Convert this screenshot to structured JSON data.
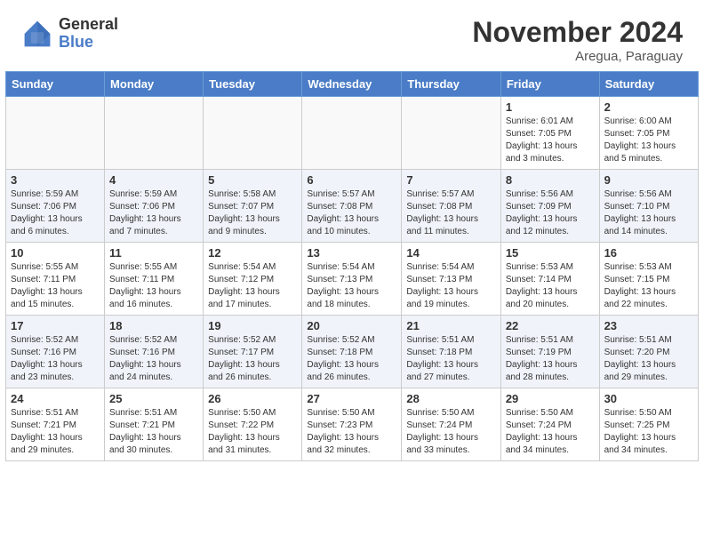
{
  "header": {
    "logo_general": "General",
    "logo_blue": "Blue",
    "month_title": "November 2024",
    "location": "Aregua, Paraguay"
  },
  "weekdays": [
    "Sunday",
    "Monday",
    "Tuesday",
    "Wednesday",
    "Thursday",
    "Friday",
    "Saturday"
  ],
  "weeks": [
    [
      {
        "day": "",
        "info": ""
      },
      {
        "day": "",
        "info": ""
      },
      {
        "day": "",
        "info": ""
      },
      {
        "day": "",
        "info": ""
      },
      {
        "day": "",
        "info": ""
      },
      {
        "day": "1",
        "info": "Sunrise: 6:01 AM\nSunset: 7:05 PM\nDaylight: 13 hours\nand 3 minutes."
      },
      {
        "day": "2",
        "info": "Sunrise: 6:00 AM\nSunset: 7:05 PM\nDaylight: 13 hours\nand 5 minutes."
      }
    ],
    [
      {
        "day": "3",
        "info": "Sunrise: 5:59 AM\nSunset: 7:06 PM\nDaylight: 13 hours\nand 6 minutes."
      },
      {
        "day": "4",
        "info": "Sunrise: 5:59 AM\nSunset: 7:06 PM\nDaylight: 13 hours\nand 7 minutes."
      },
      {
        "day": "5",
        "info": "Sunrise: 5:58 AM\nSunset: 7:07 PM\nDaylight: 13 hours\nand 9 minutes."
      },
      {
        "day": "6",
        "info": "Sunrise: 5:57 AM\nSunset: 7:08 PM\nDaylight: 13 hours\nand 10 minutes."
      },
      {
        "day": "7",
        "info": "Sunrise: 5:57 AM\nSunset: 7:08 PM\nDaylight: 13 hours\nand 11 minutes."
      },
      {
        "day": "8",
        "info": "Sunrise: 5:56 AM\nSunset: 7:09 PM\nDaylight: 13 hours\nand 12 minutes."
      },
      {
        "day": "9",
        "info": "Sunrise: 5:56 AM\nSunset: 7:10 PM\nDaylight: 13 hours\nand 14 minutes."
      }
    ],
    [
      {
        "day": "10",
        "info": "Sunrise: 5:55 AM\nSunset: 7:11 PM\nDaylight: 13 hours\nand 15 minutes."
      },
      {
        "day": "11",
        "info": "Sunrise: 5:55 AM\nSunset: 7:11 PM\nDaylight: 13 hours\nand 16 minutes."
      },
      {
        "day": "12",
        "info": "Sunrise: 5:54 AM\nSunset: 7:12 PM\nDaylight: 13 hours\nand 17 minutes."
      },
      {
        "day": "13",
        "info": "Sunrise: 5:54 AM\nSunset: 7:13 PM\nDaylight: 13 hours\nand 18 minutes."
      },
      {
        "day": "14",
        "info": "Sunrise: 5:54 AM\nSunset: 7:13 PM\nDaylight: 13 hours\nand 19 minutes."
      },
      {
        "day": "15",
        "info": "Sunrise: 5:53 AM\nSunset: 7:14 PM\nDaylight: 13 hours\nand 20 minutes."
      },
      {
        "day": "16",
        "info": "Sunrise: 5:53 AM\nSunset: 7:15 PM\nDaylight: 13 hours\nand 22 minutes."
      }
    ],
    [
      {
        "day": "17",
        "info": "Sunrise: 5:52 AM\nSunset: 7:16 PM\nDaylight: 13 hours\nand 23 minutes."
      },
      {
        "day": "18",
        "info": "Sunrise: 5:52 AM\nSunset: 7:16 PM\nDaylight: 13 hours\nand 24 minutes."
      },
      {
        "day": "19",
        "info": "Sunrise: 5:52 AM\nSunset: 7:17 PM\nDaylight: 13 hours\nand 26 minutes."
      },
      {
        "day": "20",
        "info": "Sunrise: 5:52 AM\nSunset: 7:18 PM\nDaylight: 13 hours\nand 26 minutes."
      },
      {
        "day": "21",
        "info": "Sunrise: 5:51 AM\nSunset: 7:18 PM\nDaylight: 13 hours\nand 27 minutes."
      },
      {
        "day": "22",
        "info": "Sunrise: 5:51 AM\nSunset: 7:19 PM\nDaylight: 13 hours\nand 28 minutes."
      },
      {
        "day": "23",
        "info": "Sunrise: 5:51 AM\nSunset: 7:20 PM\nDaylight: 13 hours\nand 29 minutes."
      }
    ],
    [
      {
        "day": "24",
        "info": "Sunrise: 5:51 AM\nSunset: 7:21 PM\nDaylight: 13 hours\nand 29 minutes."
      },
      {
        "day": "25",
        "info": "Sunrise: 5:51 AM\nSunset: 7:21 PM\nDaylight: 13 hours\nand 30 minutes."
      },
      {
        "day": "26",
        "info": "Sunrise: 5:50 AM\nSunset: 7:22 PM\nDaylight: 13 hours\nand 31 minutes."
      },
      {
        "day": "27",
        "info": "Sunrise: 5:50 AM\nSunset: 7:23 PM\nDaylight: 13 hours\nand 32 minutes."
      },
      {
        "day": "28",
        "info": "Sunrise: 5:50 AM\nSunset: 7:24 PM\nDaylight: 13 hours\nand 33 minutes."
      },
      {
        "day": "29",
        "info": "Sunrise: 5:50 AM\nSunset: 7:24 PM\nDaylight: 13 hours\nand 34 minutes."
      },
      {
        "day": "30",
        "info": "Sunrise: 5:50 AM\nSunset: 7:25 PM\nDaylight: 13 hours\nand 34 minutes."
      }
    ]
  ]
}
